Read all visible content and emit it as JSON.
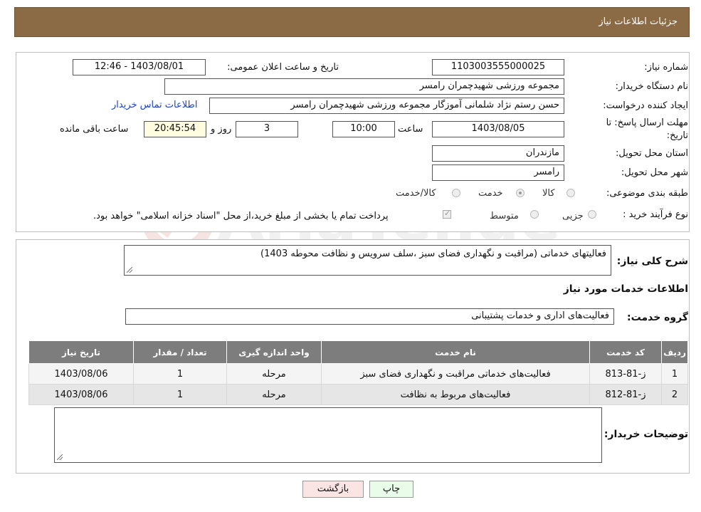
{
  "header": {
    "title": "جزئیات اطلاعات نیاز"
  },
  "form": {
    "need_number_label": "شماره نیاز:",
    "need_number": "1103003555000025",
    "announce_label": "تاریخ و ساعت اعلان عمومی:",
    "announce_value": "1403/08/01 - 12:46",
    "buyer_org_label": "نام دستگاه خریدار:",
    "buyer_org": "مجموعه ورزشی شهیدچمران رامسر",
    "creator_label": "ایجاد کننده درخواست:",
    "creator": "حسن رستم نژاد شلمانی آموزگار مجموعه ورزشی شهیدچمران رامسر",
    "contact_link": "اطلاعات تماس خریدار",
    "deadline_label_1": "مهلت ارسال پاسخ: تا",
    "deadline_label_2": "تاریخ:",
    "deadline_date": "1403/08/05",
    "time_label": "ساعت",
    "deadline_time": "10:00",
    "days_value": "3",
    "days_label": "روز و",
    "remaining_value": "20:45:54",
    "remaining_label": "ساعت باقی مانده",
    "province_label": "استان محل تحویل:",
    "province": "مازندران",
    "city_label": "شهر محل تحویل:",
    "city": "رامسر",
    "category_label": "طبقه بندی موضوعی:",
    "category_options": [
      "کالا",
      "خدمت",
      "کالا/خدمت"
    ],
    "category_selected": "خدمت",
    "process_label": "نوع فرآیند خرید :",
    "process_options": [
      "جزیی",
      "متوسط"
    ],
    "payment_note": "پرداخت تمام یا بخشی از مبلغ خرید،از محل \"اسناد خزانه اسلامی\" خواهد بود."
  },
  "summary": {
    "label": "شرح کلی نیاز:",
    "text": "فعالیتهای خدماتی (مراقبت و نگهداری فضای سبز ،سلف سرویس و نظافت محوطه 1403)"
  },
  "services": {
    "section_title": "اطلاعات خدمات مورد نیاز",
    "group_label": "گروه خدمت:",
    "group_value": "فعالیت‌های اداری و خدمات پشتیبانی",
    "columns": [
      "ردیف",
      "کد خدمت",
      "نام خدمت",
      "واحد اندازه گیری",
      "تعداد / مقدار",
      "تاریخ نیاز"
    ],
    "rows": [
      [
        "1",
        "ز-81-813",
        "فعالیت‌های خدماتی مراقبت و نگهداری فضای سبز",
        "مرحله",
        "1",
        "1403/08/06"
      ],
      [
        "2",
        "ز-81-812",
        "فعالیت‌های مربوط به نظافت",
        "مرحله",
        "1",
        "1403/08/06"
      ]
    ]
  },
  "buyer_notes": {
    "label": "توضیحات خریدار:",
    "text": ""
  },
  "buttons": {
    "print": "چاپ",
    "back": "بازگشت"
  },
  "watermark": {
    "text": "AriaTender.neT"
  },
  "colors": {
    "header_bg": "#8b6a46",
    "table_header_bg": "#7d7d7d",
    "print_btn": "#e9fbe9",
    "back_btn": "#fbe4e4"
  }
}
